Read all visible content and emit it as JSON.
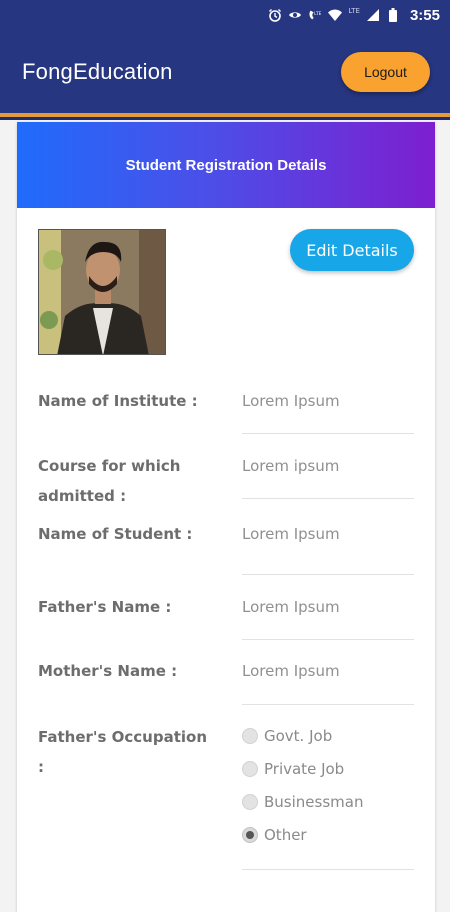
{
  "status_bar": {
    "time": "3:55",
    "network": "LTE",
    "icons": [
      "alarm-icon",
      "eye-icon",
      "volte-icon",
      "wifi-icon",
      "signal-icon",
      "battery-icon"
    ]
  },
  "app_bar": {
    "title": "FongEducation",
    "logout_label": "Logout"
  },
  "card": {
    "title": "Student Registration Details",
    "edit_label": "Edit Details",
    "fields": [
      {
        "label": "Name of Institute :",
        "value": "Lorem Ipsum"
      },
      {
        "label": "Course for which admitted :",
        "value": "Lorem ipsum"
      },
      {
        "label": "Name of Student :",
        "value": "Lorem Ipsum"
      },
      {
        "label": "Father's Name :",
        "value": "Lorem Ipsum"
      },
      {
        "label": "Mother's Name :",
        "value": "Lorem Ipsum"
      }
    ],
    "occupation": {
      "label": "Father's Occupation :",
      "options": [
        "Govt. Job",
        "Private Job",
        "Businessman",
        "Other"
      ],
      "selected": "Other"
    }
  },
  "colors": {
    "app_bar": "#263680",
    "accent_orange": "#f9a230",
    "edit_button": "#17a6e8",
    "header_gradient_start": "#1f6cfb",
    "header_gradient_end": "#7d1fd0"
  }
}
